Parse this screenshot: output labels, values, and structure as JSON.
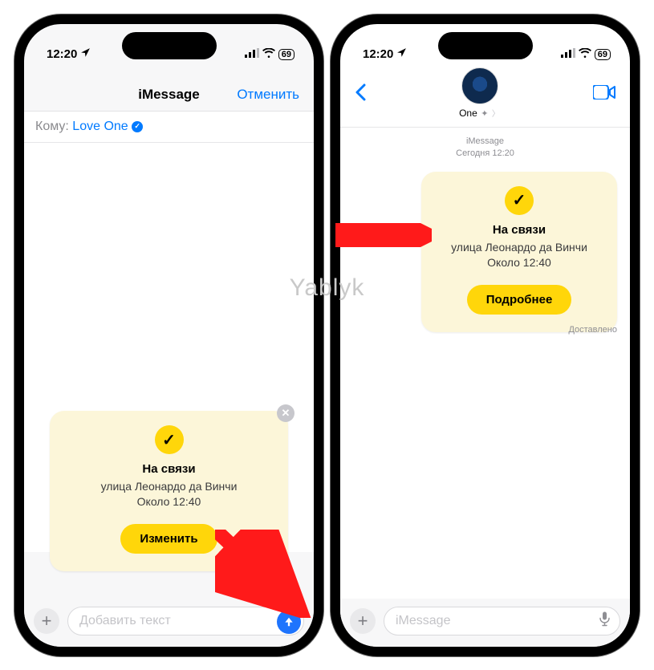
{
  "status": {
    "time": "12:20",
    "battery": "69"
  },
  "left": {
    "nav_title": "iMessage",
    "cancel": "Отменить",
    "to_label": "Кому:",
    "contact": "Love One",
    "card": {
      "title": "На связи",
      "street": "улица Леонардо да Винчи",
      "eta": "Около 12:40",
      "button": "Изменить"
    },
    "input_placeholder": "Добавить текст"
  },
  "right": {
    "contact_name": "One",
    "thread_system": "iMessage",
    "thread_time": "Сегодня 12:20",
    "card": {
      "title": "На связи",
      "street": "улица Леонардо да Винчи",
      "eta": "Около 12:40",
      "button": "Подробнее"
    },
    "delivered": "Доставлено",
    "input_placeholder": "iMessage"
  },
  "watermark": "Yablyk"
}
